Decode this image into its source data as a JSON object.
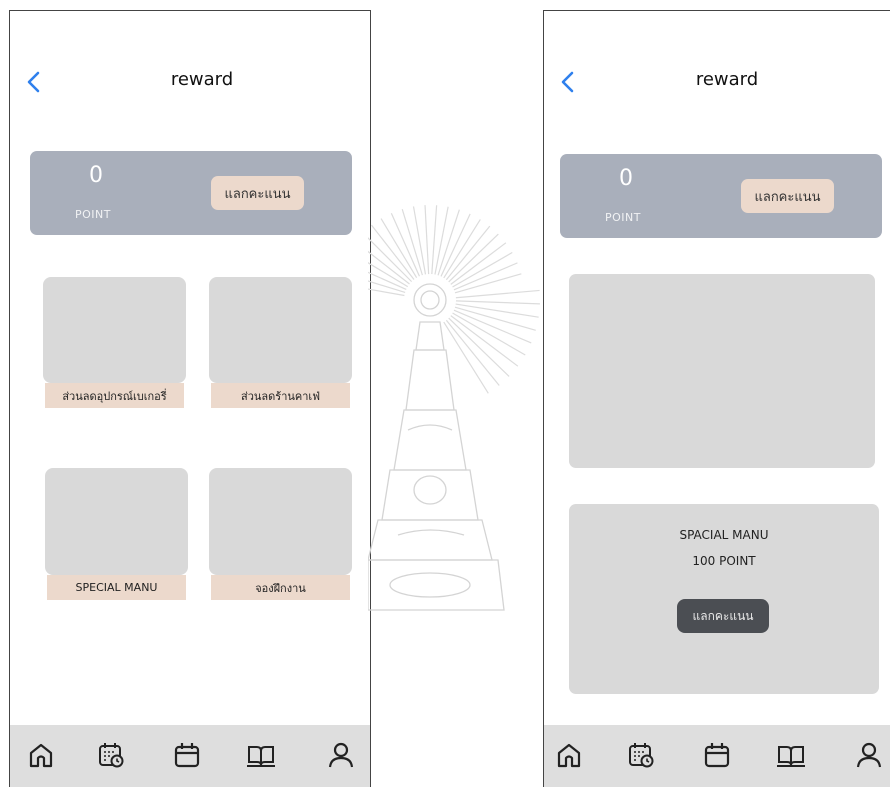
{
  "left": {
    "header": {
      "title": "reward"
    },
    "points": {
      "value": "0",
      "unit": "POINT",
      "redeem_label": "แลกคะแนน"
    },
    "rewards": [
      {
        "label": "ส่วนลดอุปกรณ์เบเกอรี่"
      },
      {
        "label": "ส่วนลดร้านคาเฟ่"
      },
      {
        "label": "SPECIAL MANU"
      },
      {
        "label": "จองฝึกงาน"
      }
    ]
  },
  "right": {
    "header": {
      "title": "reward"
    },
    "points": {
      "value": "0",
      "unit": "POINT",
      "redeem_label": "แลกคะแนน"
    },
    "detail": {
      "name": "SPACIAL MANU",
      "price": "100 POINT",
      "redeem_label": "แลกคะแนน"
    }
  },
  "nav": {
    "items": [
      {
        "icon": "home-icon"
      },
      {
        "icon": "calendar-clock-icon"
      },
      {
        "icon": "calendar-icon"
      },
      {
        "icon": "book-icon"
      },
      {
        "icon": "user-icon"
      }
    ]
  },
  "colors": {
    "accent": "#2f80ed",
    "card": "#a9afbb",
    "chip": "#ecd9cc",
    "tile": "#d9d9d9",
    "nav_bg": "#dedede",
    "dark_button": "#4b4e53"
  }
}
